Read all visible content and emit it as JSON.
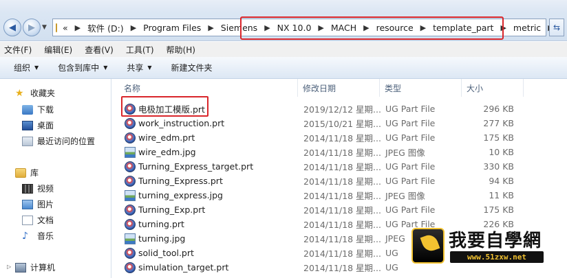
{
  "address_bar": {
    "crumbs": [
      "软件 (D:)",
      "Program Files",
      "Siemens",
      "NX 10.0",
      "MACH",
      "resource",
      "template_part",
      "metric"
    ],
    "prefix": "«"
  },
  "menu": [
    "文件(F)",
    "编辑(E)",
    "查看(V)",
    "工具(T)",
    "帮助(H)"
  ],
  "toolbar": {
    "organize": "组织",
    "include_in_library": "包含到库中",
    "share": "共享",
    "new_folder": "新建文件夹"
  },
  "nav": {
    "favorites": "收藏夹",
    "downloads": "下载",
    "desktop": "桌面",
    "recent": "最近访问的位置",
    "libraries": "库",
    "videos": "视频",
    "pictures": "图片",
    "documents": "文档",
    "music": "音乐",
    "computer": "计算机"
  },
  "columns": {
    "name": "名称",
    "date": "修改日期",
    "type": "类型",
    "size": "大小"
  },
  "files": [
    {
      "name": "电极加工模版.prt",
      "date": "2019/12/12 星期...",
      "type": "UG Part File",
      "size": "296 KB",
      "icon": "prt"
    },
    {
      "name": "work_instruction.prt",
      "date": "2015/10/21 星期...",
      "type": "UG Part File",
      "size": "277 KB",
      "icon": "prt"
    },
    {
      "name": "wire_edm.prt",
      "date": "2014/11/18 星期...",
      "type": "UG Part File",
      "size": "175 KB",
      "icon": "prt"
    },
    {
      "name": "wire_edm.jpg",
      "date": "2014/11/18 星期...",
      "type": "JPEG 图像",
      "size": "10 KB",
      "icon": "jpg"
    },
    {
      "name": "Turning_Express_target.prt",
      "date": "2014/11/18 星期...",
      "type": "UG Part File",
      "size": "330 KB",
      "icon": "prt"
    },
    {
      "name": "Turning_Express.prt",
      "date": "2014/11/18 星期...",
      "type": "UG Part File",
      "size": "94 KB",
      "icon": "prt"
    },
    {
      "name": "turning_express.jpg",
      "date": "2014/11/18 星期...",
      "type": "JPEG 图像",
      "size": "11 KB",
      "icon": "jpg"
    },
    {
      "name": "Turning_Exp.prt",
      "date": "2014/11/18 星期...",
      "type": "UG Part File",
      "size": "175 KB",
      "icon": "prt"
    },
    {
      "name": "turning.prt",
      "date": "2014/11/18 星期...",
      "type": "UG Part File",
      "size": "226 KB",
      "icon": "prt"
    },
    {
      "name": "turning.jpg",
      "date": "2014/11/18 星期...",
      "type": "JPEG",
      "size": "",
      "icon": "jpg"
    },
    {
      "name": "solid_tool.prt",
      "date": "2014/11/18 星期...",
      "type": "UG",
      "size": "",
      "icon": "prt"
    },
    {
      "name": "simulation_target.prt",
      "date": "2014/11/18 星期...",
      "type": "UG",
      "size": "",
      "icon": "prt"
    }
  ],
  "watermark": {
    "text": "我要自學網",
    "url": "www.51zxw.net"
  }
}
